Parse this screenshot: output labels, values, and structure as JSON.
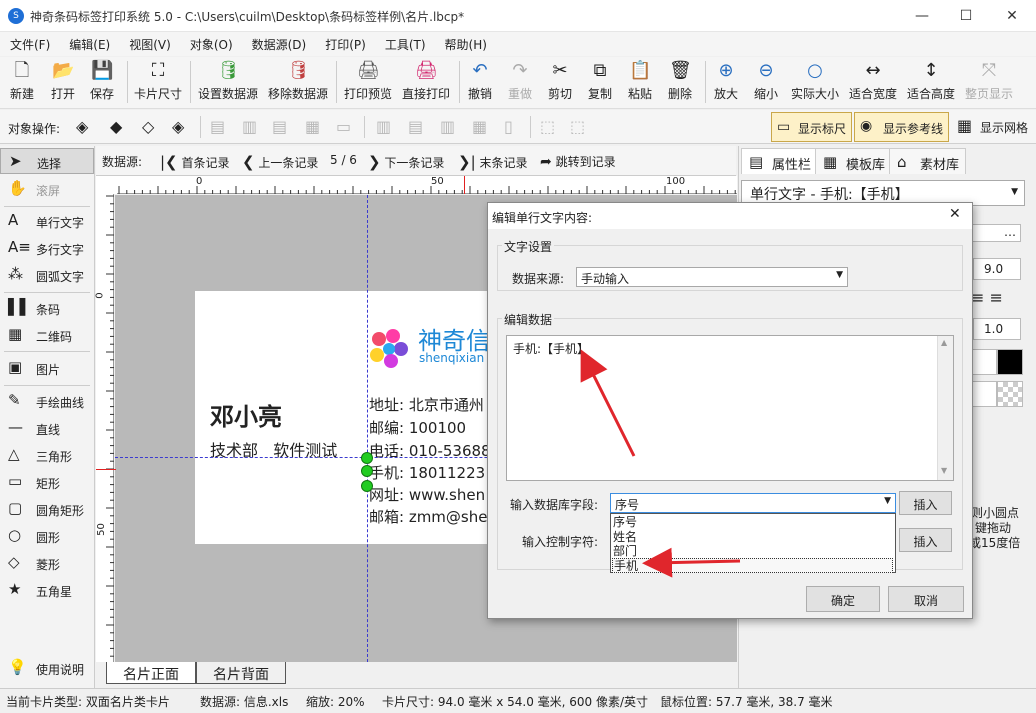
{
  "window": {
    "title": "神奇条码标签打印系统 5.0 - C:\\Users\\cuilm\\Desktop\\条码标签样例\\名片.lbcp*",
    "app_icon_glyph": "S",
    "min": "—",
    "max": "☐",
    "close": "✕"
  },
  "menu": [
    "文件(F)",
    "编辑(E)",
    "视图(V)",
    "对象(O)",
    "数据源(D)",
    "打印(P)",
    "工具(T)",
    "帮助(H)"
  ],
  "toolbar": [
    {
      "label": "新建",
      "icon": "new-file-icon",
      "glyph": "🗋"
    },
    {
      "label": "打开",
      "icon": "open-icon",
      "glyph": "📂"
    },
    {
      "label": "保存",
      "icon": "save-icon",
      "glyph": "💾"
    },
    {
      "label": "卡片尺寸",
      "icon": "card-size-icon",
      "glyph": "⛶"
    },
    {
      "label": "设置数据源",
      "icon": "database-add-icon",
      "glyph": "🛢"
    },
    {
      "label": "移除数据源",
      "icon": "database-remove-icon",
      "glyph": "🛢"
    },
    {
      "label": "打印预览",
      "icon": "print-preview-icon",
      "glyph": "🖨"
    },
    {
      "label": "直接打印",
      "icon": "printer-icon",
      "glyph": "🖨"
    },
    {
      "label": "撤销",
      "icon": "undo-icon",
      "glyph": "↶"
    },
    {
      "label": "重做",
      "icon": "redo-icon",
      "glyph": "↷"
    },
    {
      "label": "剪切",
      "icon": "scissors-icon",
      "glyph": "✂"
    },
    {
      "label": "复制",
      "icon": "copy-icon",
      "glyph": "⧉"
    },
    {
      "label": "粘贴",
      "icon": "paste-icon",
      "glyph": "📋"
    },
    {
      "label": "删除",
      "icon": "trash-icon",
      "glyph": "🗑"
    },
    {
      "label": "放大",
      "icon": "zoom-in-icon",
      "glyph": "⊕"
    },
    {
      "label": "缩小",
      "icon": "zoom-out-icon",
      "glyph": "⊖"
    },
    {
      "label": "实际大小",
      "icon": "magnifier-icon",
      "glyph": "○"
    },
    {
      "label": "适合宽度",
      "icon": "fit-width-icon",
      "glyph": "↔"
    },
    {
      "label": "适合高度",
      "icon": "fit-height-icon",
      "glyph": "↕"
    },
    {
      "label": "整页显示",
      "icon": "fit-page-icon",
      "glyph": "⤧"
    }
  ],
  "objbar": {
    "label": "对象操作:",
    "show_ruler": "显示标尺",
    "show_guides": "显示参考线",
    "show_grid": "显示网格"
  },
  "tools": [
    {
      "label": "选择",
      "icon": "pointer-icon",
      "glyph": "➤"
    },
    {
      "label": "滚屏",
      "icon": "hand-icon",
      "glyph": "✋"
    },
    {
      "label": "单行文字",
      "icon": "single-text-icon",
      "glyph": "A"
    },
    {
      "label": "多行文字",
      "icon": "multi-text-icon",
      "glyph": "A≡"
    },
    {
      "label": "圆弧文字",
      "icon": "arc-text-icon",
      "glyph": "⁂"
    },
    {
      "label": "条码",
      "icon": "barcode-icon",
      "glyph": "▌▌"
    },
    {
      "label": "二维码",
      "icon": "qrcode-icon",
      "glyph": "▦"
    },
    {
      "label": "图片",
      "icon": "image-icon",
      "glyph": "▣"
    },
    {
      "label": "手绘曲线",
      "icon": "pen-icon",
      "glyph": "✎"
    },
    {
      "label": "直线",
      "icon": "line-icon",
      "glyph": "—"
    },
    {
      "label": "三角形",
      "icon": "triangle-icon",
      "glyph": "△"
    },
    {
      "label": "矩形",
      "icon": "rectangle-icon",
      "glyph": "▭"
    },
    {
      "label": "圆角矩形",
      "icon": "rounded-rect-icon",
      "glyph": "▢"
    },
    {
      "label": "圆形",
      "icon": "circle-icon",
      "glyph": "○"
    },
    {
      "label": "菱形",
      "icon": "diamond-icon",
      "glyph": "◇"
    },
    {
      "label": "五角星",
      "icon": "star-icon",
      "glyph": "★"
    },
    {
      "label": "使用说明",
      "icon": "lightbulb-icon",
      "glyph": "💡"
    }
  ],
  "nav": {
    "label": "数据源:",
    "first": "首条记录",
    "prev": "上一条记录",
    "counter": "5 / 6",
    "next": "下一条记录",
    "last": "末条记录",
    "jump": "跳转到记录"
  },
  "ruler": {
    "h": [
      "0",
      "50",
      "100"
    ],
    "v": [
      "0",
      "50"
    ]
  },
  "card": {
    "name": "邓小亮",
    "dept": "技术部   软件测试",
    "brand": "神奇信",
    "brand_sub": "shenqixian",
    "lines": [
      "地址: 北京市通州",
      "邮编: 100100",
      "电话: 010-53688",
      "手机: 18011223",
      "网址: www.shen",
      "邮箱: zmm@she"
    ]
  },
  "page_tabs": [
    "名片正面",
    "名片背面"
  ],
  "status": {
    "card_type": "当前卡片类型: 双面名片类卡片",
    "source": "数据源: 信息.xls",
    "zoom": "缩放: 20%",
    "size": "卡片尺寸: 94.0 毫米 x 54.0 毫米, 600 像素/英寸",
    "mouse": "鼠标位置: 57.7 毫米, 38.7 毫米"
  },
  "right": {
    "tabs": [
      "属性栏",
      "模板库",
      "素材库"
    ],
    "object_combo": "单行文字 - 手机:【手机】",
    "font_size": "9.0",
    "spacing": "1.0",
    "hint_lines": [
      "则小圆点",
      "键拖动",
      "或15度倍"
    ]
  },
  "dialog": {
    "title": "编辑单行文字内容:",
    "close": "✕",
    "group_text": "文字设置",
    "source_label": "数据来源:",
    "source_value": "手动输入",
    "group_edit": "编辑数据",
    "edit_text": "手机:【手机】",
    "db_field_label": "输入数据库字段:",
    "db_field_value": "序号",
    "insert": "插入",
    "ctrl_label": "输入控制字符:",
    "dropdown": [
      "序号",
      "姓名",
      "部门",
      "手机"
    ],
    "ok": "确定",
    "cancel": "取消"
  },
  "colors": {
    "accent": "#1f6fd6",
    "arrow": "#e0262c",
    "handle": "#22cc22",
    "brand": "#1e88d6"
  }
}
